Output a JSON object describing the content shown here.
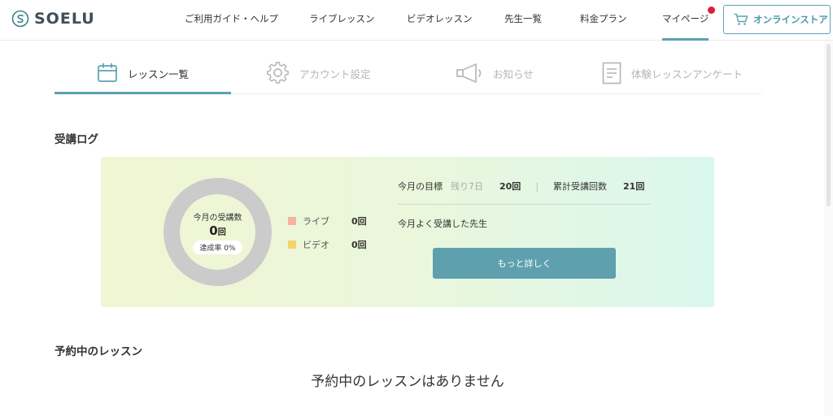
{
  "header": {
    "logo_text": "SOELU",
    "nav": [
      {
        "label": "ご利用ガイド・ヘルプ"
      },
      {
        "label": "ライブレッスン"
      },
      {
        "label": "ビデオレッスン"
      },
      {
        "label": "先生一覧"
      },
      {
        "label": "料金プラン"
      },
      {
        "label": "マイページ"
      }
    ],
    "store_button": "オンラインストア",
    "accent_color": "#5aa3b0",
    "notification_color": "#d8203e"
  },
  "tabs": [
    {
      "label": "レッスン一覧",
      "icon": "calendar-icon",
      "active": true
    },
    {
      "label": "アカウント設定",
      "icon": "gear-icon",
      "active": false
    },
    {
      "label": "お知らせ",
      "icon": "megaphone-icon",
      "active": false
    },
    {
      "label": "体験レッスンアンケート",
      "icon": "survey-icon",
      "active": false
    }
  ],
  "log": {
    "title": "受講ログ",
    "donut": {
      "label": "今月の受講数",
      "count": "0",
      "count_unit": "回",
      "rate": "達成率 0%",
      "progress": 0
    },
    "legend": [
      {
        "name": "ライブ",
        "value": "0回",
        "color": "#f5b3a3"
      },
      {
        "name": "ビデオ",
        "value": "0回",
        "color": "#f3d46c"
      }
    ],
    "goal_label": "今月の目標",
    "days_left": "残り7日",
    "goal_value": "20回",
    "total_label": "累計受講回数",
    "total_value": "21回",
    "frequent_teacher_label": "今月よく受講した先生",
    "more_button": "もっと詳しく"
  },
  "reserved": {
    "title": "予約中のレッスン",
    "empty_message": "予約中のレッスンはありません"
  }
}
